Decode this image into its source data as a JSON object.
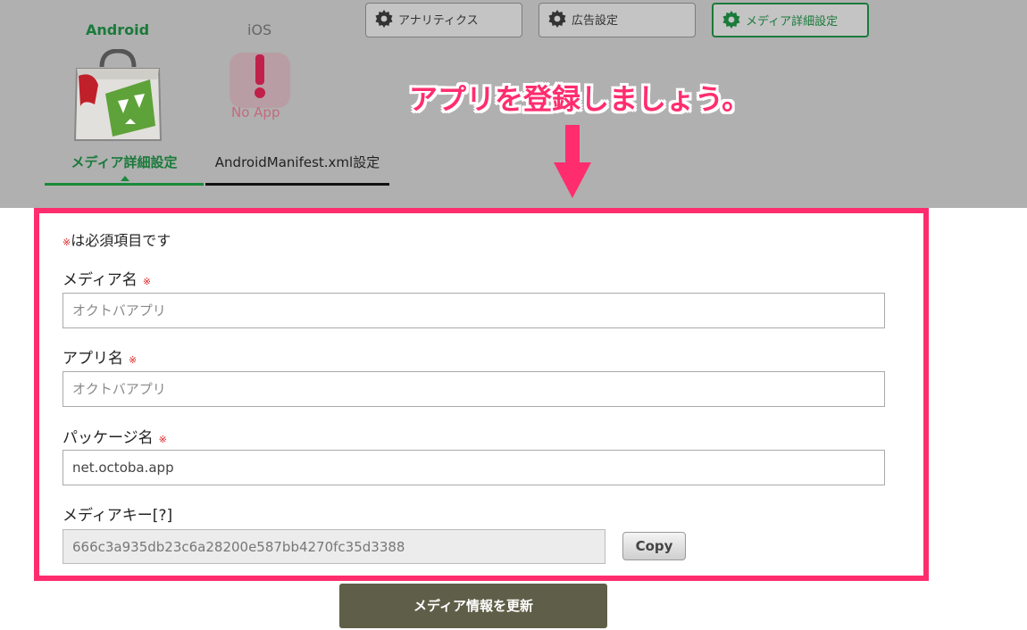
{
  "platforms": {
    "android": "Android",
    "ios": "iOS",
    "no_app_text": "No App"
  },
  "subtabs": {
    "active": "メディア詳細設定",
    "inactive": "AndroidManifest.xml設定"
  },
  "settings_buttons": [
    {
      "label": "アナリティクス",
      "icon": "gear-icon"
    },
    {
      "label": "広告設定",
      "icon": "gear-icon"
    },
    {
      "label": "メディア詳細設定",
      "icon": "gear-icon",
      "active": true
    }
  ],
  "annotation": {
    "text": "アプリを登録しましょう。",
    "color": "#ff2d6e"
  },
  "form": {
    "required_mark": "※",
    "required_note": "は必須項目です",
    "media_name": {
      "label": "メディア名",
      "placeholder": "オクトバアプリ"
    },
    "app_name": {
      "label": "アプリ名",
      "placeholder": "オクトバアプリ"
    },
    "package_name": {
      "label": "パッケージ名",
      "value": "net.octoba.app"
    },
    "media_key": {
      "label": "メディアキー[?]",
      "value": "666c3a935db23c6a28200e587bb4270fc35d3388",
      "copy_label": "Copy"
    },
    "submit_label": "メディア情報を更新"
  },
  "colors": {
    "android_green": "#1a7a3a",
    "highlight": "#ff2d6e",
    "submit_bg": "#5f5e48",
    "overlay": "#b0b0b0"
  }
}
